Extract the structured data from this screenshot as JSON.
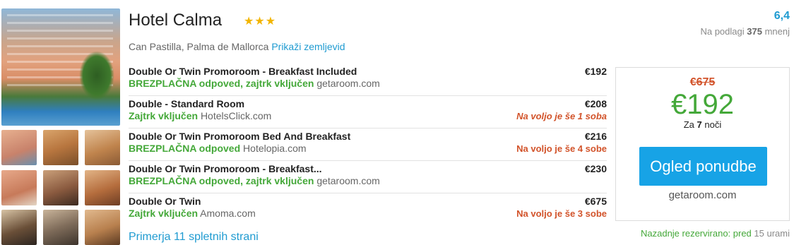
{
  "hotel": {
    "name": "Hotel Calma",
    "stars_text": "★★★",
    "star_count": 3,
    "location": "Can Pastilla, Palma de Mallorca",
    "map_link": "Prikaži zemljevid"
  },
  "rating": {
    "score": "6,4",
    "reviews_prefix": "Na podlagi",
    "reviews_count": "375",
    "reviews_suffix": "mnenj"
  },
  "deals": [
    {
      "name": "Double Or Twin Promoroom - Breakfast Included",
      "price": "€192",
      "perk": "BREZPLAČNA odpoved, zajtrk vključen",
      "provider": "getaroom.com",
      "availability": ""
    },
    {
      "name": "Double - Standard Room",
      "price": "€208",
      "perk": "Zajtrk vključen",
      "provider": "HotelsClick.com",
      "availability": "Na voljo je še 1 soba"
    },
    {
      "name": "Double Or Twin Promoroom Bed And Breakfast",
      "price": "€216",
      "perk": "BREZPLAČNA odpoved",
      "provider": "Hotelopia.com",
      "availability": "Na voljo je še 4 sobe"
    },
    {
      "name": "Double Or Twin Promoroom - Breakfast...",
      "price": "€230",
      "perk": "BREZPLAČNA odpoved, zajtrk vključen",
      "provider": "getaroom.com",
      "availability": ""
    },
    {
      "name": "Double Or Twin",
      "price": "€675",
      "perk": "Zajtrk vključen",
      "provider": "Amoma.com",
      "availability": "Na voljo je še 3 sobe"
    }
  ],
  "more_sites": "Primerja 11 spletnih strani",
  "offer": {
    "old_price": "€675",
    "price": "€192",
    "nights_prefix": "Za",
    "nights": "7",
    "nights_suffix": "noči",
    "button": "Ogled ponudbe",
    "provider": "getaroom.com"
  },
  "last_booked": {
    "prefix": "Nazadnje rezervirano: pred",
    "value": "15 urami"
  },
  "colors": {
    "accent_blue": "#1f9bd1",
    "button_blue": "#17a3e6",
    "green": "#44a839",
    "orange_red": "#d2532a",
    "star": "#f2b500"
  }
}
